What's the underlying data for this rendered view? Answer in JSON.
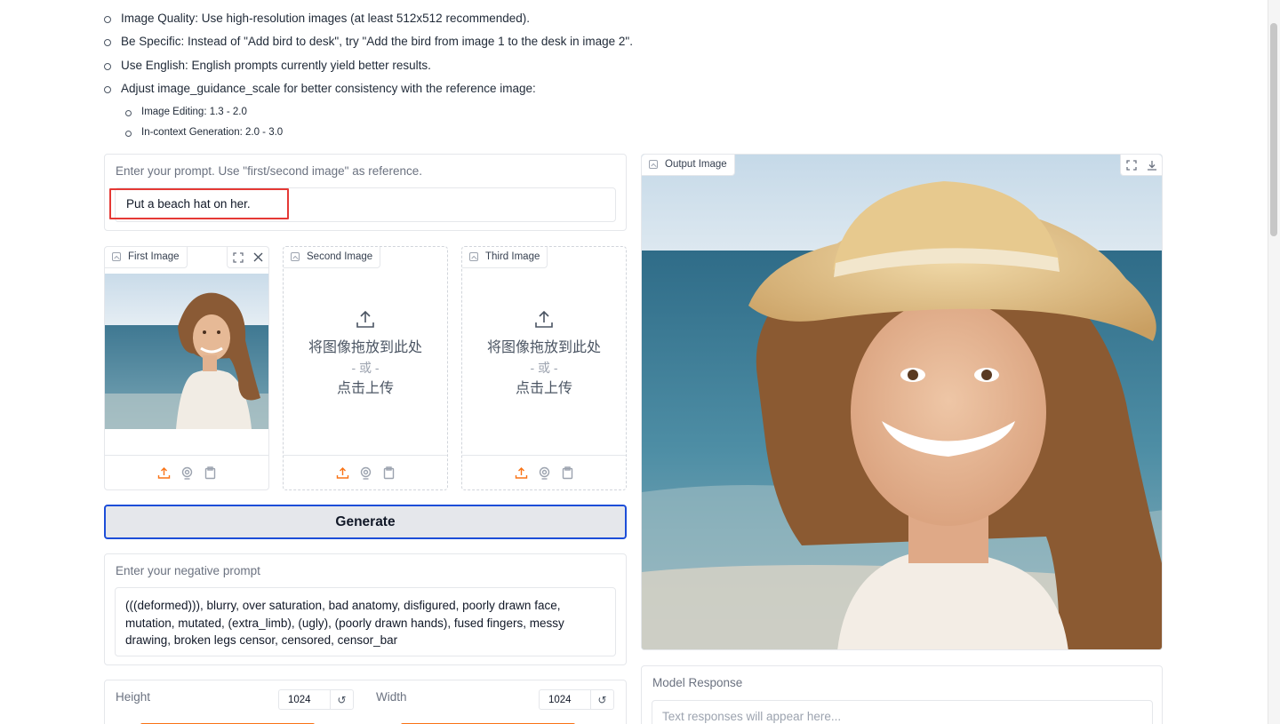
{
  "tips": {
    "items": [
      "Image Quality: Use high-resolution images (at least 512x512 recommended).",
      "Be Specific: Instead of \"Add bird to desk\", try \"Add the bird from image 1 to the desk in image 2\".",
      "Use English: English prompts currently yield better results.",
      "Adjust image_guidance_scale for better consistency with the reference image:"
    ],
    "sub_items": [
      "Image Editing: 1.3 - 2.0",
      "In-context Generation: 2.0 - 3.0"
    ]
  },
  "prompt": {
    "label": "Enter your prompt. Use \"first/second image\" as reference.",
    "value": "Put a beach hat on her."
  },
  "images": {
    "first": {
      "label": "First Image"
    },
    "second": {
      "label": "Second Image",
      "drop_line1": "将图像拖放到此处",
      "drop_or": "- 或 -",
      "drop_line2": "点击上传"
    },
    "third": {
      "label": "Third Image",
      "drop_line1": "将图像拖放到此处",
      "drop_or": "- 或 -",
      "drop_line2": "点击上传"
    }
  },
  "generate_label": "Generate",
  "negative": {
    "label": "Enter your negative prompt",
    "value": "(((deformed))), blurry, over saturation, bad anatomy, disfigured, poorly drawn face, mutation, mutated, (extra_limb), (ugly), (poorly drawn hands), fused fingers, messy drawing, broken legs censor, censored, censor_bar"
  },
  "height": {
    "label": "Height",
    "value": "1024"
  },
  "width": {
    "label": "Width",
    "value": "1024"
  },
  "output": {
    "label": "Output Image"
  },
  "response": {
    "label": "Model Response",
    "placeholder": "Text responses will appear here..."
  },
  "colors": {
    "accent": "#f97316",
    "highlight": "#e53935",
    "focus": "#1d4ed8"
  }
}
